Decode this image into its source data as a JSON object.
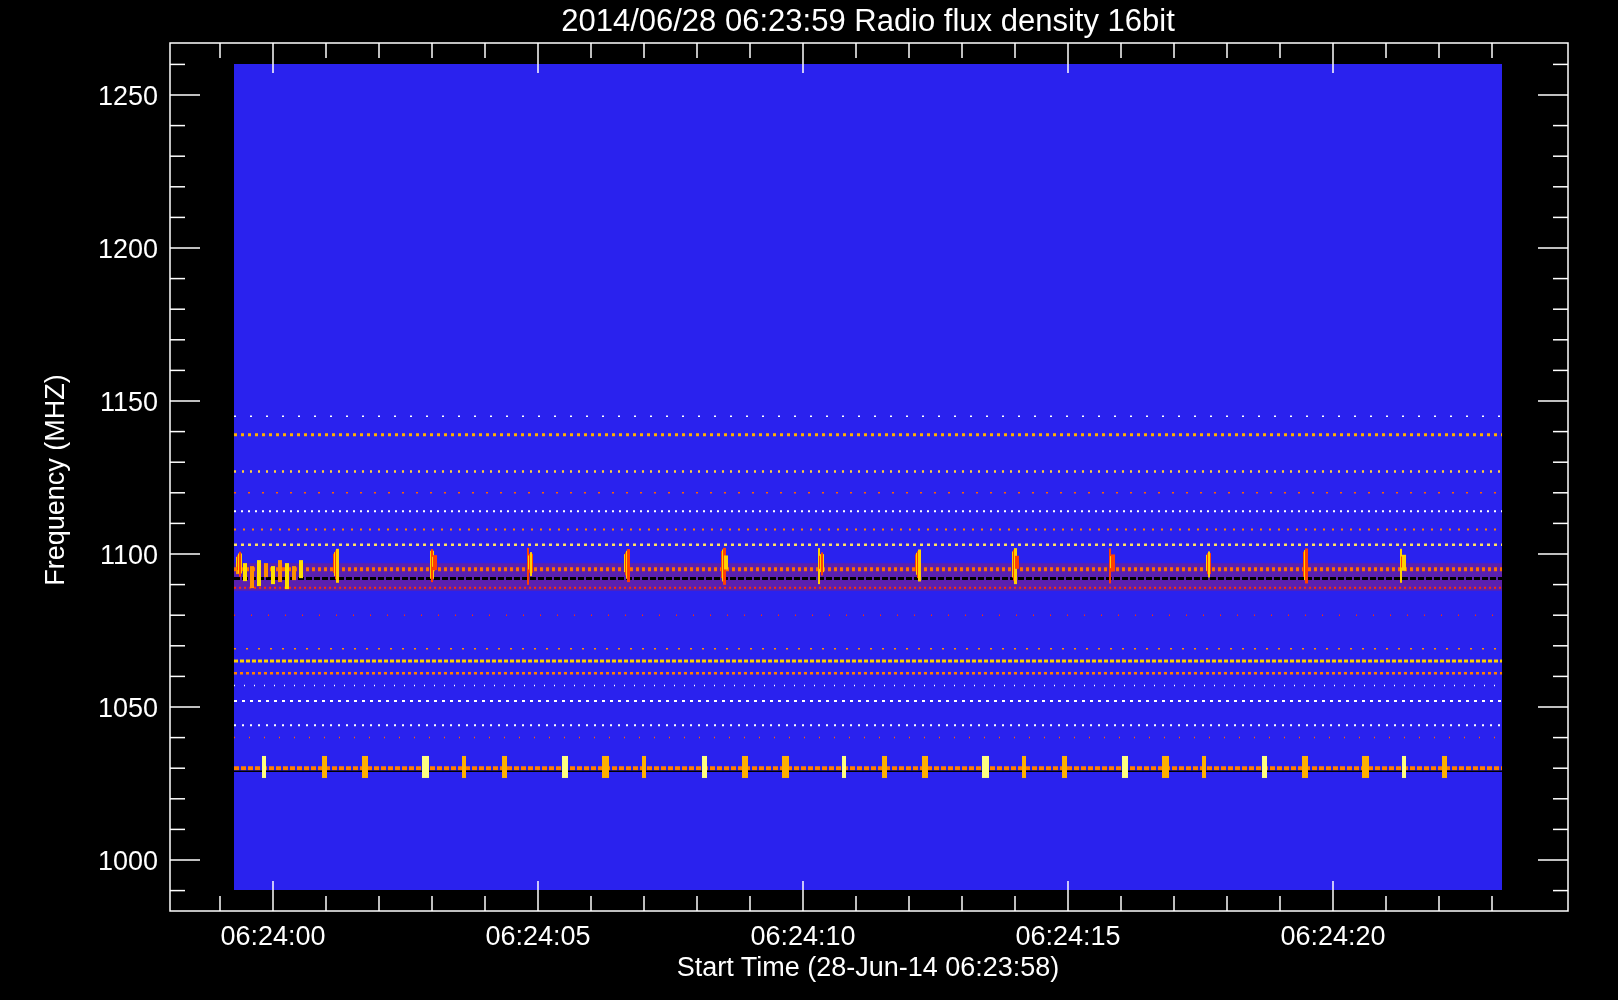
{
  "title": "2014/06/28 06:23:59 Radio flux density 16bit",
  "y_axis": {
    "label": "Frequency (MHZ)",
    "ticks": [
      "1250",
      "1200",
      "1150",
      "1100",
      "1050",
      "1000"
    ]
  },
  "x_axis": {
    "label": "Start Time (28-Jun-14 06:23:58)",
    "ticks": [
      "06:24:00",
      "06:24:05",
      "06:24:10",
      "06:24:15",
      "06:24:20"
    ]
  }
}
